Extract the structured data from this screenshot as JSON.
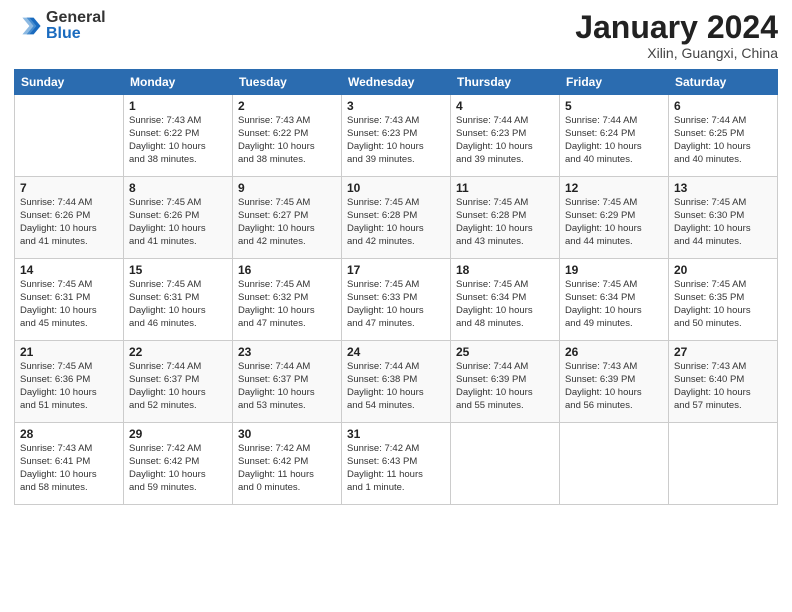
{
  "logo": {
    "general": "General",
    "blue": "Blue"
  },
  "title": {
    "month_year": "January 2024",
    "location": "Xilin, Guangxi, China"
  },
  "days_of_week": [
    "Sunday",
    "Monday",
    "Tuesday",
    "Wednesday",
    "Thursday",
    "Friday",
    "Saturday"
  ],
  "weeks": [
    [
      {
        "day": "",
        "info": ""
      },
      {
        "day": "1",
        "info": "Sunrise: 7:43 AM\nSunset: 6:22 PM\nDaylight: 10 hours\nand 38 minutes."
      },
      {
        "day": "2",
        "info": "Sunrise: 7:43 AM\nSunset: 6:22 PM\nDaylight: 10 hours\nand 38 minutes."
      },
      {
        "day": "3",
        "info": "Sunrise: 7:43 AM\nSunset: 6:23 PM\nDaylight: 10 hours\nand 39 minutes."
      },
      {
        "day": "4",
        "info": "Sunrise: 7:44 AM\nSunset: 6:23 PM\nDaylight: 10 hours\nand 39 minutes."
      },
      {
        "day": "5",
        "info": "Sunrise: 7:44 AM\nSunset: 6:24 PM\nDaylight: 10 hours\nand 40 minutes."
      },
      {
        "day": "6",
        "info": "Sunrise: 7:44 AM\nSunset: 6:25 PM\nDaylight: 10 hours\nand 40 minutes."
      }
    ],
    [
      {
        "day": "7",
        "info": "Sunrise: 7:44 AM\nSunset: 6:26 PM\nDaylight: 10 hours\nand 41 minutes."
      },
      {
        "day": "8",
        "info": "Sunrise: 7:45 AM\nSunset: 6:26 PM\nDaylight: 10 hours\nand 41 minutes."
      },
      {
        "day": "9",
        "info": "Sunrise: 7:45 AM\nSunset: 6:27 PM\nDaylight: 10 hours\nand 42 minutes."
      },
      {
        "day": "10",
        "info": "Sunrise: 7:45 AM\nSunset: 6:28 PM\nDaylight: 10 hours\nand 42 minutes."
      },
      {
        "day": "11",
        "info": "Sunrise: 7:45 AM\nSunset: 6:28 PM\nDaylight: 10 hours\nand 43 minutes."
      },
      {
        "day": "12",
        "info": "Sunrise: 7:45 AM\nSunset: 6:29 PM\nDaylight: 10 hours\nand 44 minutes."
      },
      {
        "day": "13",
        "info": "Sunrise: 7:45 AM\nSunset: 6:30 PM\nDaylight: 10 hours\nand 44 minutes."
      }
    ],
    [
      {
        "day": "14",
        "info": "Sunrise: 7:45 AM\nSunset: 6:31 PM\nDaylight: 10 hours\nand 45 minutes."
      },
      {
        "day": "15",
        "info": "Sunrise: 7:45 AM\nSunset: 6:31 PM\nDaylight: 10 hours\nand 46 minutes."
      },
      {
        "day": "16",
        "info": "Sunrise: 7:45 AM\nSunset: 6:32 PM\nDaylight: 10 hours\nand 47 minutes."
      },
      {
        "day": "17",
        "info": "Sunrise: 7:45 AM\nSunset: 6:33 PM\nDaylight: 10 hours\nand 47 minutes."
      },
      {
        "day": "18",
        "info": "Sunrise: 7:45 AM\nSunset: 6:34 PM\nDaylight: 10 hours\nand 48 minutes."
      },
      {
        "day": "19",
        "info": "Sunrise: 7:45 AM\nSunset: 6:34 PM\nDaylight: 10 hours\nand 49 minutes."
      },
      {
        "day": "20",
        "info": "Sunrise: 7:45 AM\nSunset: 6:35 PM\nDaylight: 10 hours\nand 50 minutes."
      }
    ],
    [
      {
        "day": "21",
        "info": "Sunrise: 7:45 AM\nSunset: 6:36 PM\nDaylight: 10 hours\nand 51 minutes."
      },
      {
        "day": "22",
        "info": "Sunrise: 7:44 AM\nSunset: 6:37 PM\nDaylight: 10 hours\nand 52 minutes."
      },
      {
        "day": "23",
        "info": "Sunrise: 7:44 AM\nSunset: 6:37 PM\nDaylight: 10 hours\nand 53 minutes."
      },
      {
        "day": "24",
        "info": "Sunrise: 7:44 AM\nSunset: 6:38 PM\nDaylight: 10 hours\nand 54 minutes."
      },
      {
        "day": "25",
        "info": "Sunrise: 7:44 AM\nSunset: 6:39 PM\nDaylight: 10 hours\nand 55 minutes."
      },
      {
        "day": "26",
        "info": "Sunrise: 7:43 AM\nSunset: 6:39 PM\nDaylight: 10 hours\nand 56 minutes."
      },
      {
        "day": "27",
        "info": "Sunrise: 7:43 AM\nSunset: 6:40 PM\nDaylight: 10 hours\nand 57 minutes."
      }
    ],
    [
      {
        "day": "28",
        "info": "Sunrise: 7:43 AM\nSunset: 6:41 PM\nDaylight: 10 hours\nand 58 minutes."
      },
      {
        "day": "29",
        "info": "Sunrise: 7:42 AM\nSunset: 6:42 PM\nDaylight: 10 hours\nand 59 minutes."
      },
      {
        "day": "30",
        "info": "Sunrise: 7:42 AM\nSunset: 6:42 PM\nDaylight: 11 hours\nand 0 minutes."
      },
      {
        "day": "31",
        "info": "Sunrise: 7:42 AM\nSunset: 6:43 PM\nDaylight: 11 hours\nand 1 minute."
      },
      {
        "day": "",
        "info": ""
      },
      {
        "day": "",
        "info": ""
      },
      {
        "day": "",
        "info": ""
      }
    ]
  ]
}
